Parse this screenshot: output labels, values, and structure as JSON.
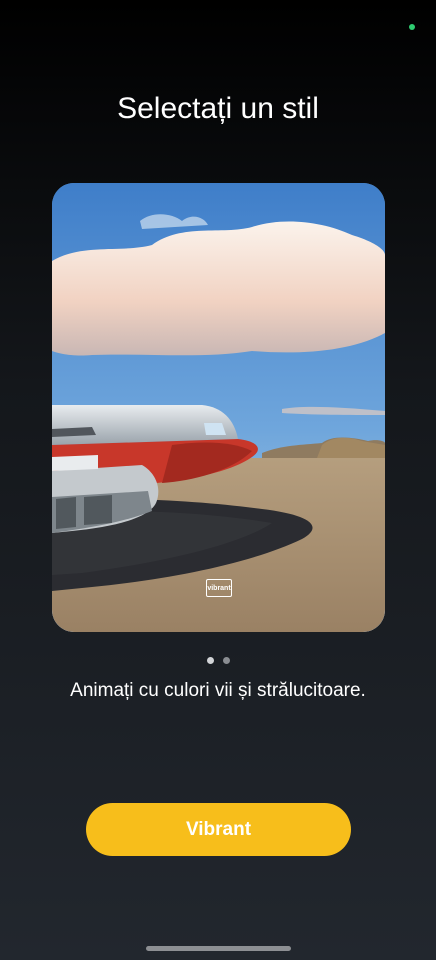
{
  "status_bar": {
    "indicator_color": "#2ecc71",
    "indicator_icon": "status-dot"
  },
  "header": {
    "title": "Selectați un stil"
  },
  "preview": {
    "image": "desert-plane-wreck-photo",
    "badge_label": "vibrant",
    "badge_icon": "vibrant-style-badge"
  },
  "pager": {
    "count": 2,
    "active_index": 0
  },
  "description": "Animați cu culori vii și strălucitoare.",
  "primary_action": {
    "label": "Vibrant",
    "color": "#f7be1b"
  }
}
